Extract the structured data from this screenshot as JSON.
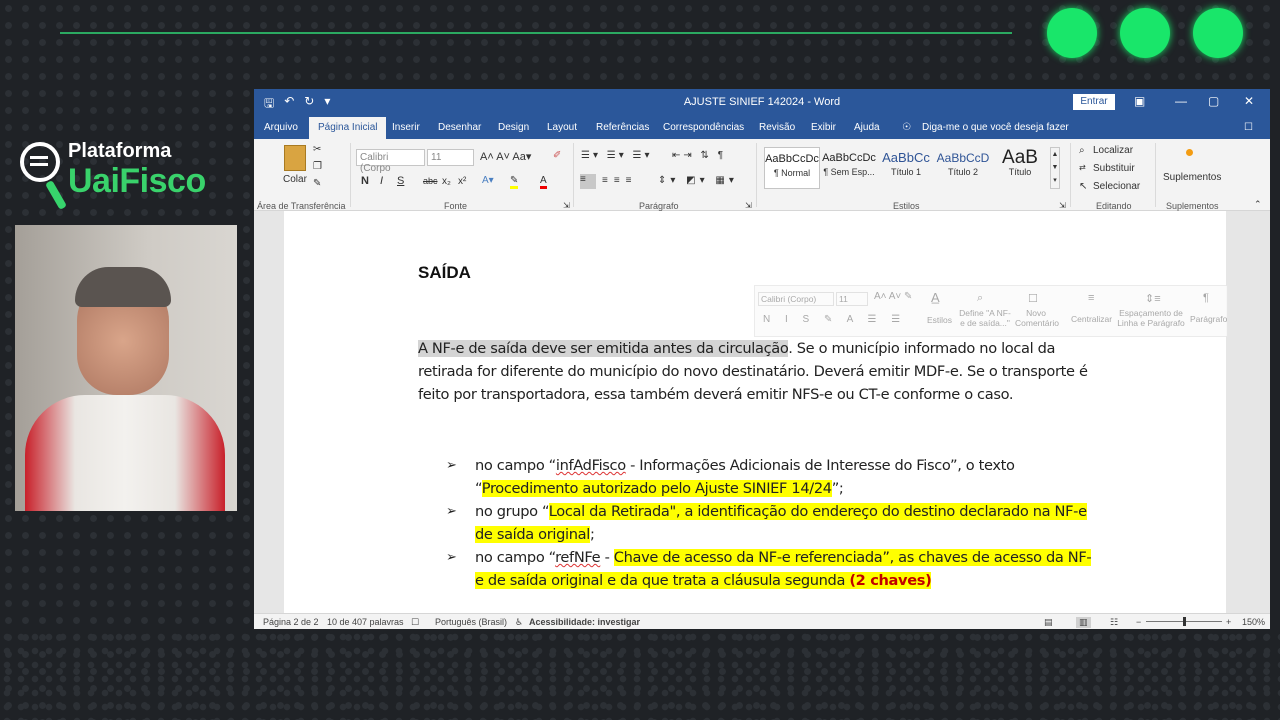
{
  "brand": {
    "line1": "Plataforma",
    "line2": "UaiFisco"
  },
  "word": {
    "title": "AJUSTE SINIEF 142024  -  Word",
    "signin": "Entrar",
    "menu": [
      "Arquivo",
      "Página Inicial",
      "Inserir",
      "Desenhar",
      "Design",
      "Layout",
      "Referências",
      "Correspondências",
      "Revisão",
      "Exibir",
      "Ajuda"
    ],
    "tell_me": "Diga-me o que você deseja fazer",
    "ribbon": {
      "paste": "Colar",
      "clipboard_label": "Área de Transferência",
      "font_name": "Calibri (Corpo",
      "font_size": "11",
      "font_label": "Fonte",
      "paragraph_label": "Parágrafo",
      "styles": [
        {
          "preview": "AaBbCcDc",
          "name": "¶ Normal"
        },
        {
          "preview": "AaBbCcDc",
          "name": "¶ Sem Esp..."
        },
        {
          "preview": "AaBbCc",
          "name": "Título 1"
        },
        {
          "preview": "AaBbCcD",
          "name": "Título 2"
        },
        {
          "preview": "AaB",
          "name": "Título"
        }
      ],
      "styles_label": "Estilos",
      "find": "Localizar",
      "replace": "Substituir",
      "select": "Selecionar",
      "editing_label": "Editando",
      "addins": "Suplementos",
      "addins_label": "Suplementos"
    },
    "mini_toolbar": {
      "font": "Calibri (Corpo)",
      "size": "11",
      "styles": "Estilos",
      "define": "Define \"A NF-e de saída...\"",
      "new_comment": "Novo Comentário",
      "center": "Centralizar",
      "spacing": "Espaçamento de Linha e Parágrafo",
      "paragraph": "Parágrafo"
    },
    "document": {
      "heading": "SAÍDA",
      "para_selected": "A NF-e de saída deve ser emitida antes da circulação",
      "para_rest": ". Se o município informado no local da retirada for diferente do município do novo destinatário. Deverá emitir MDF-e. Se o transporte é feito por transportadora, essa também deverá emitir NFS-e ou CT-e conforme o caso.",
      "bullet1_pre": "no campo “",
      "bullet1_field": "infAdFisco",
      "bullet1_mid": " - Informações Adicionais de Interesse do Fisco”, o texto “",
      "bullet1_hl": "Procedimento autorizado pelo Ajuste SINIEF 14/24",
      "bullet1_end": "”;",
      "bullet2_pre": "no grupo “",
      "bullet2_hl": "Local da Retirada\", a identificação do endereço do destino declarado na NF-e de saída original",
      "bullet2_end": ";",
      "bullet3_pre": "no campo “",
      "bullet3_field": "refNFe",
      "bullet3_mid": " - ",
      "bullet3_hl": "Chave de acesso da NF-e referenciada”, as chaves de acesso da NF-e de saída original e da que trata a cláusula segunda",
      "bullet3_space": " ",
      "bullet3_red": "(2 chaves)"
    },
    "status": {
      "page": "Página 2 de 2",
      "words": "10 de 407 palavras",
      "language": "Português (Brasil)",
      "accessibility": "Acessibilidade: investigar",
      "zoom": "150%"
    }
  }
}
